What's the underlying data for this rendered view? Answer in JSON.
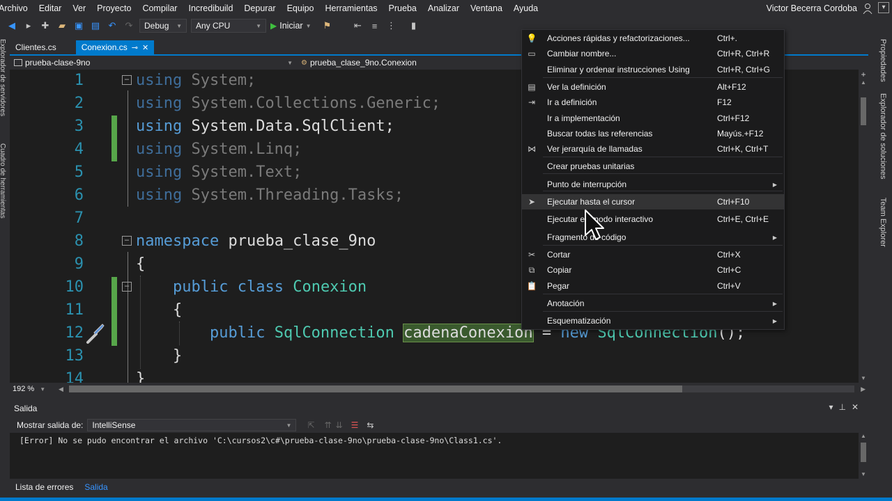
{
  "menu": [
    "Archivo",
    "Editar",
    "Ver",
    "Proyecto",
    "Compilar",
    "Incredibuild",
    "Depurar",
    "Equipo",
    "Herramientas",
    "Prueba",
    "Analizar",
    "Ventana",
    "Ayuda"
  ],
  "user": "Victor Becerra Cordoba",
  "toolbar": {
    "config": "Debug",
    "platform": "Any CPU",
    "run": "Iniciar"
  },
  "left_strip": [
    "Explorador de servidores",
    "Cuadro de herramientas"
  ],
  "right_strip": [
    "Propiedades",
    "Explorador de soluciones",
    "Team Explorer"
  ],
  "tabs": [
    {
      "label": "Clientes.cs",
      "active": false
    },
    {
      "label": "Conexion.cs",
      "active": true
    }
  ],
  "nav": {
    "project": "prueba-clase-9no",
    "class": "prueba_clase_9no.Conexion"
  },
  "code": {
    "lines": [
      {
        "n": "1",
        "kw": "using",
        "rest": " System;"
      },
      {
        "n": "2",
        "kw": "using",
        "rest": " System.Collections.Generic;"
      },
      {
        "n": "3",
        "kw": "using",
        "rest": " System.Data.SqlClient;"
      },
      {
        "n": "4",
        "kw": "using",
        "rest": " System.Linq;"
      },
      {
        "n": "5",
        "kw": "using",
        "rest": " System.Text;"
      },
      {
        "n": "6",
        "kw": "using",
        "rest": " System.Threading.Tasks;"
      },
      {
        "n": "7"
      },
      {
        "n": "8",
        "kw": "namespace",
        "rest": " prueba_clase_9no"
      },
      {
        "n": "9",
        "rest": "{"
      },
      {
        "n": "10",
        "kw1": "public",
        "kw2": "class",
        "type": "Conexion"
      },
      {
        "n": "11",
        "rest": "{"
      },
      {
        "n": "12",
        "kw1": "public",
        "type": "SqlConnection",
        "ident": "cadenaConexion",
        "eq": " = ",
        "kw2": "new",
        "type2": "SqlConnection",
        "tail": "();"
      },
      {
        "n": "13",
        "rest": "}"
      },
      {
        "n": "14",
        "rest": "}"
      }
    ]
  },
  "zoom": "192 %",
  "output": {
    "title": "Salida",
    "show_label": "Mostrar salida de:",
    "source": "IntelliSense",
    "text": "[Error] No se pudo encontrar el archivo 'C:\\cursos2\\c#\\prueba-clase-9no\\prueba-clase-9no\\Class1.cs'."
  },
  "bottom_tabs": [
    {
      "label": "Lista de errores",
      "active": false
    },
    {
      "label": "Salida",
      "active": true
    }
  ],
  "context_menu": [
    {
      "label": "Acciones rápidas y refactorizaciones...",
      "shortcut": "Ctrl+.",
      "icon": "lightbulb-icon",
      "glyph": "💡"
    },
    {
      "label": "Cambiar nombre...",
      "shortcut": "Ctrl+R, Ctrl+R",
      "icon": "rename-icon",
      "glyph": "▭"
    },
    {
      "label": "Eliminar y ordenar instrucciones Using",
      "shortcut": "Ctrl+R, Ctrl+G"
    },
    {
      "label": "Ver la definición",
      "shortcut": "Alt+F12",
      "icon": "peek-icon",
      "glyph": "▤"
    },
    {
      "label": "Ir a definición",
      "shortcut": "F12",
      "icon": "goto-icon",
      "glyph": "⇥"
    },
    {
      "label": "Ir a implementación",
      "shortcut": "Ctrl+F12"
    },
    {
      "label": "Buscar todas las referencias",
      "shortcut": "Mayús.+F12"
    },
    {
      "label": "Ver jerarquía de llamadas",
      "shortcut": "Ctrl+K, Ctrl+T",
      "icon": "hierarchy-icon",
      "glyph": "⋈"
    },
    {
      "label": "Crear pruebas unitarias",
      "shortcut": ""
    },
    {
      "label": "Punto de interrupción",
      "shortcut": "",
      "submenu": true
    },
    {
      "label": "Ejecutar hasta el cursor",
      "shortcut": "Ctrl+F10",
      "icon": "run-to-cursor-icon",
      "glyph": "➤",
      "hover": true
    },
    {
      "label": "Ejecutar en modo interactivo",
      "shortcut": "Ctrl+E, Ctrl+E"
    },
    {
      "label": "Fragmento de código",
      "shortcut": "",
      "submenu": true
    },
    {
      "label": "Cortar",
      "shortcut": "Ctrl+X",
      "icon": "cut-icon",
      "glyph": "✂"
    },
    {
      "label": "Copiar",
      "shortcut": "Ctrl+C",
      "icon": "copy-icon",
      "glyph": "⧉"
    },
    {
      "label": "Pegar",
      "shortcut": "Ctrl+V",
      "icon": "paste-icon",
      "glyph": "📋"
    },
    {
      "label": "Anotación",
      "shortcut": "",
      "submenu": true
    },
    {
      "label": "Esquematización",
      "shortcut": "",
      "submenu": true
    }
  ],
  "colors": {
    "accent": "#007acc",
    "keyword": "#569cd6",
    "type": "#4ec9b0",
    "linenum": "#2b91af",
    "changed": "#57a64a"
  }
}
